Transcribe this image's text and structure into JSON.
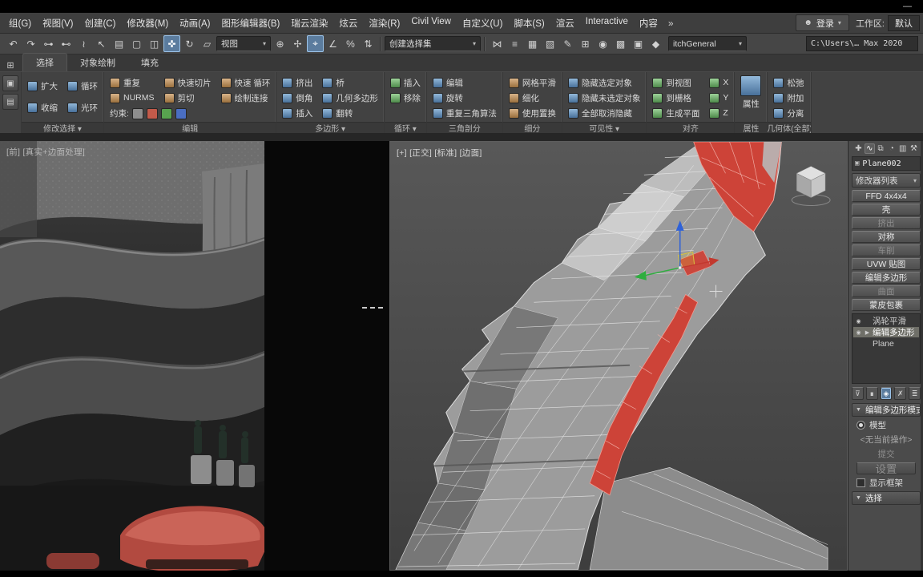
{
  "window": {
    "minimize": "—"
  },
  "menu_bar": {
    "items": [
      "组(G)",
      "视图(V)",
      "创建(C)",
      "修改器(M)",
      "动画(A)",
      "图形编辑器(B)",
      "瑞云渲染",
      "炫云",
      "渲染(R)",
      "Civil View",
      "自定义(U)",
      "脚本(S)",
      "渲云",
      "Interactive",
      "内容"
    ],
    "overflow": "»",
    "login_label": "登录",
    "workspace_label": "工作区:",
    "workspace_value": "默认",
    "caret": "▾"
  },
  "toolbar": {
    "icons_left": [
      {
        "glyph": "↶",
        "name": "undo-icon"
      },
      {
        "glyph": "↷",
        "name": "redo-icon"
      },
      {
        "glyph": "⊶",
        "name": "select-and-link-icon"
      },
      {
        "glyph": "⊷",
        "name": "unlink-selection-icon"
      },
      {
        "glyph": "≀",
        "name": "bind-to-space-warp-icon"
      },
      {
        "glyph": "↖",
        "name": "select-object-icon"
      },
      {
        "glyph": "▤",
        "name": "select-by-name-icon"
      },
      {
        "glyph": "▢",
        "name": "rectangular-selection-region-icon"
      },
      {
        "glyph": "◫",
        "name": "window-crossing-icon"
      },
      {
        "glyph": "✜",
        "name": "select-and-move-icon",
        "active": true
      },
      {
        "glyph": "↻",
        "name": "select-and-rotate-icon"
      },
      {
        "glyph": "▱",
        "name": "select-and-scale-icon"
      }
    ],
    "ref_coord_combo": "视图",
    "icons_mid": [
      {
        "glyph": "⊕",
        "name": "use-pivot-center-icon"
      },
      {
        "glyph": "✢",
        "name": "select-and-manipulate-icon"
      },
      {
        "glyph": "⌖",
        "name": "snaps-toggle-icon",
        "active": true
      },
      {
        "glyph": "∠",
        "name": "angle-snap-icon"
      },
      {
        "glyph": "%",
        "name": "percent-snap-icon"
      },
      {
        "glyph": "⇅",
        "name": "spinner-snap-icon"
      }
    ],
    "selection_set_combo": "创建选择集",
    "icons_right": [
      {
        "glyph": "⋈",
        "name": "mirror-icon"
      },
      {
        "glyph": "≡",
        "name": "align-icon"
      },
      {
        "glyph": "▦",
        "name": "layer-manager-icon"
      },
      {
        "glyph": "▧",
        "name": "graphite-ribbon-icon"
      },
      {
        "glyph": "✎",
        "name": "curve-editor-icon"
      },
      {
        "glyph": "⊞",
        "name": "schematic-view-icon"
      },
      {
        "glyph": "◉",
        "name": "material-editor-icon"
      },
      {
        "glyph": "▩",
        "name": "render-setup-icon"
      },
      {
        "glyph": "▣",
        "name": "rendered-frame-icon"
      },
      {
        "glyph": "◆",
        "name": "render-production-icon"
      }
    ],
    "general_combo": "itchGeneral",
    "project_path": "C:\\Users\\… Max 2020",
    "caret": "▾"
  },
  "ribbon": {
    "tabs_icon": "⊞",
    "tabs": [
      "选择",
      "对象绘制",
      "填充"
    ],
    "minicol_icons": [
      {
        "glyph": "▣",
        "name": "ribbon-preview-icon"
      },
      {
        "glyph": "▤",
        "name": "ribbon-config-icon"
      }
    ],
    "constraints_label": "约束:",
    "groups": [
      {
        "label": "修改选择 ▾",
        "buttons": [
          "扩大",
          "收缩",
          "循环",
          "光环"
        ]
      },
      {
        "label": "编辑",
        "buttons": [
          "重复",
          "NURMS",
          "快速切片",
          "剪切",
          "快速 循环",
          "绘制连接"
        ]
      },
      {
        "label": "多边形 ▾",
        "buttons": [
          "挤出",
          "倒角",
          "插入",
          "桥",
          "几何多边形",
          "翻转"
        ]
      },
      {
        "label": "循环 ▾",
        "buttons": [
          "插入",
          "移除"
        ]
      },
      {
        "label": "三角剖分",
        "buttons": [
          "编辑",
          "旋转",
          "重复三角算法"
        ]
      },
      {
        "label": "细分",
        "buttons": [
          "网格平滑",
          "细化",
          "使用置换"
        ]
      },
      {
        "label": "可见性 ▾",
        "buttons": [
          "隐藏选定对象",
          "隐藏未选定对象",
          "全部取消隐藏"
        ]
      },
      {
        "label": "对齐",
        "buttons": [
          "到视图",
          "到栅格",
          "生成平面",
          "X",
          "Y",
          "Z"
        ]
      },
      {
        "label": "属性",
        "buttons": [
          "属性"
        ]
      },
      {
        "label": "几何体(全部)",
        "buttons": [
          "松弛",
          "附加",
          "分离"
        ]
      }
    ]
  },
  "viewport_left": {
    "label": "[前] [真实+边面处理]"
  },
  "viewport_main": {
    "label": "[+] [正交] [标准] [边面]"
  },
  "command_panel": {
    "tabs": [
      {
        "glyph": "✚",
        "name": "create-tab-icon"
      },
      {
        "glyph": "∿",
        "name": "modify-tab-icon",
        "active": true
      },
      {
        "glyph": "⧉",
        "name": "hierarchy-tab-icon"
      },
      {
        "glyph": "◔",
        "name": "motion-tab-icon"
      },
      {
        "glyph": "▥",
        "name": "display-tab-icon"
      },
      {
        "glyph": "⚒",
        "name": "utilities-tab-icon"
      }
    ],
    "object_icon": "▣",
    "object_name": "Plane002",
    "modifier_list_label": "修改器列表",
    "modifier_buttons": [
      {
        "label": "FFD 4x4x4"
      },
      {
        "label": "壳"
      },
      {
        "label": "挤出",
        "dim": true
      },
      {
        "label": "对称"
      },
      {
        "label": "车削",
        "dim": true
      },
      {
        "label": "UVW 贴图"
      },
      {
        "label": "编辑多边形"
      },
      {
        "label": "曲面",
        "dim": true
      },
      {
        "label": "蒙皮包裹"
      }
    ],
    "stack_items": [
      {
        "label": "涡轮平滑",
        "eye": true
      },
      {
        "label": "编辑多边形",
        "selected": true,
        "eye": true,
        "expander": true
      },
      {
        "label": "Plane",
        "indent": true
      }
    ],
    "stack_tools": [
      {
        "glyph": "⊽",
        "name": "pin-stack-icon"
      },
      {
        "glyph": "∎",
        "name": "show-end-result-icon"
      },
      {
        "glyph": "◈",
        "name": "make-unique-icon",
        "active": true
      },
      {
        "glyph": "✗",
        "name": "remove-modifier-icon"
      },
      {
        "glyph": "≣",
        "name": "configure-modifier-sets-icon"
      }
    ],
    "mode_section": {
      "caret": "▼",
      "title": "编辑多边形模式",
      "radio_label": "模型",
      "current_operation": "<无当前操作>",
      "commit_label": "提交",
      "settings_label": "设置",
      "show_cage_label": "显示框架"
    },
    "selection_section": {
      "caret": "▼",
      "title": "选择"
    }
  },
  "colors": {
    "selection_red": "#cd4338",
    "highlight_blue": "#5b7c9e",
    "axis_x": "#c2382e",
    "axis_y": "#2fae3f",
    "axis_z": "#2f62d8"
  }
}
